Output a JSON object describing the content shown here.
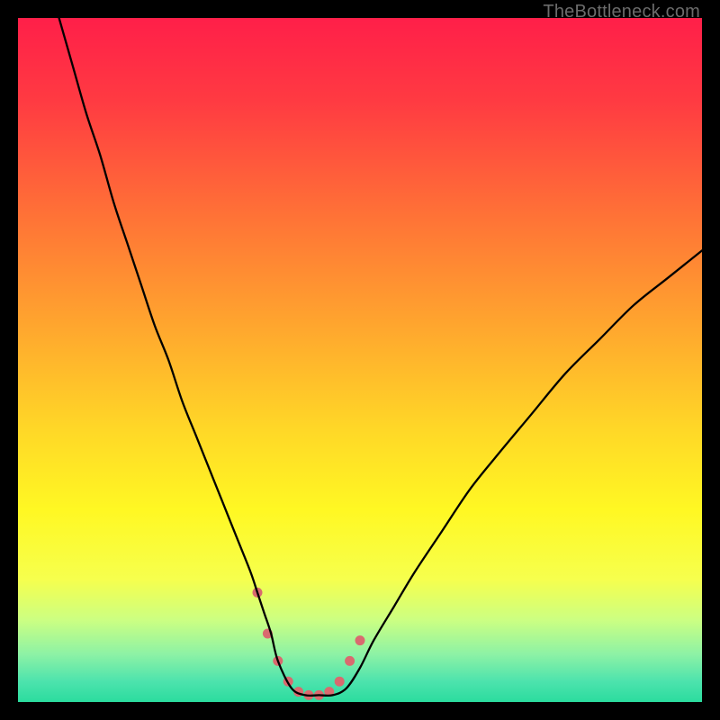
{
  "watermark": "TheBottleneck.com",
  "chart_data": {
    "type": "line",
    "title": "",
    "xlabel": "",
    "ylabel": "",
    "xrange": [
      0,
      100
    ],
    "yrange": [
      0,
      100
    ],
    "grid": false,
    "legend": false,
    "background": {
      "type": "vertical-gradient",
      "stops": [
        {
          "offset": 0.0,
          "color": "#ff1f49"
        },
        {
          "offset": 0.12,
          "color": "#ff3a42"
        },
        {
          "offset": 0.28,
          "color": "#ff6f37"
        },
        {
          "offset": 0.45,
          "color": "#ffa62e"
        },
        {
          "offset": 0.6,
          "color": "#ffd727"
        },
        {
          "offset": 0.72,
          "color": "#fff823"
        },
        {
          "offset": 0.82,
          "color": "#f6ff4d"
        },
        {
          "offset": 0.88,
          "color": "#ccff82"
        },
        {
          "offset": 0.93,
          "color": "#8df2a5"
        },
        {
          "offset": 0.97,
          "color": "#4de3ad"
        },
        {
          "offset": 1.0,
          "color": "#2bdc9e"
        }
      ]
    },
    "series": [
      {
        "name": "bottleneck-curve",
        "color": "#000000",
        "stroke_width": 2.3,
        "x": [
          6,
          8,
          10,
          12,
          14,
          16,
          18,
          20,
          22,
          24,
          26,
          28,
          30,
          32,
          34,
          35,
          36,
          37,
          38,
          40,
          42,
          44,
          46,
          48,
          50,
          52,
          55,
          58,
          62,
          66,
          70,
          75,
          80,
          85,
          90,
          95,
          100
        ],
        "y": [
          100,
          93,
          86,
          80,
          73,
          67,
          61,
          55,
          50,
          44,
          39,
          34,
          29,
          24,
          19,
          16,
          13,
          10,
          6,
          2,
          1,
          1,
          1,
          2,
          5,
          9,
          14,
          19,
          25,
          31,
          36,
          42,
          48,
          53,
          58,
          62,
          66
        ]
      },
      {
        "name": "optimal-zone-marker",
        "type": "scatter",
        "color": "#d96a6f",
        "marker_size": 11,
        "x": [
          35.0,
          36.5,
          38.0,
          39.5,
          41.0,
          42.5,
          44.0,
          45.5,
          47.0,
          48.5,
          50.0
        ],
        "y": [
          16.0,
          10.0,
          6.0,
          3.0,
          1.5,
          1.0,
          1.0,
          1.5,
          3.0,
          6.0,
          9.0
        ]
      }
    ],
    "notes": "Axes are unlabeled in the source image; values are percentage estimates (0–100) read from the plot area. The curve is an asymmetric V: steep descent from top-left to a flat minimum around x≈42–46, then a gentler rise toward the right edge reaching roughly y≈66 at x=100. The scatter series marks the salmon-colored dotted region near the trough."
  }
}
